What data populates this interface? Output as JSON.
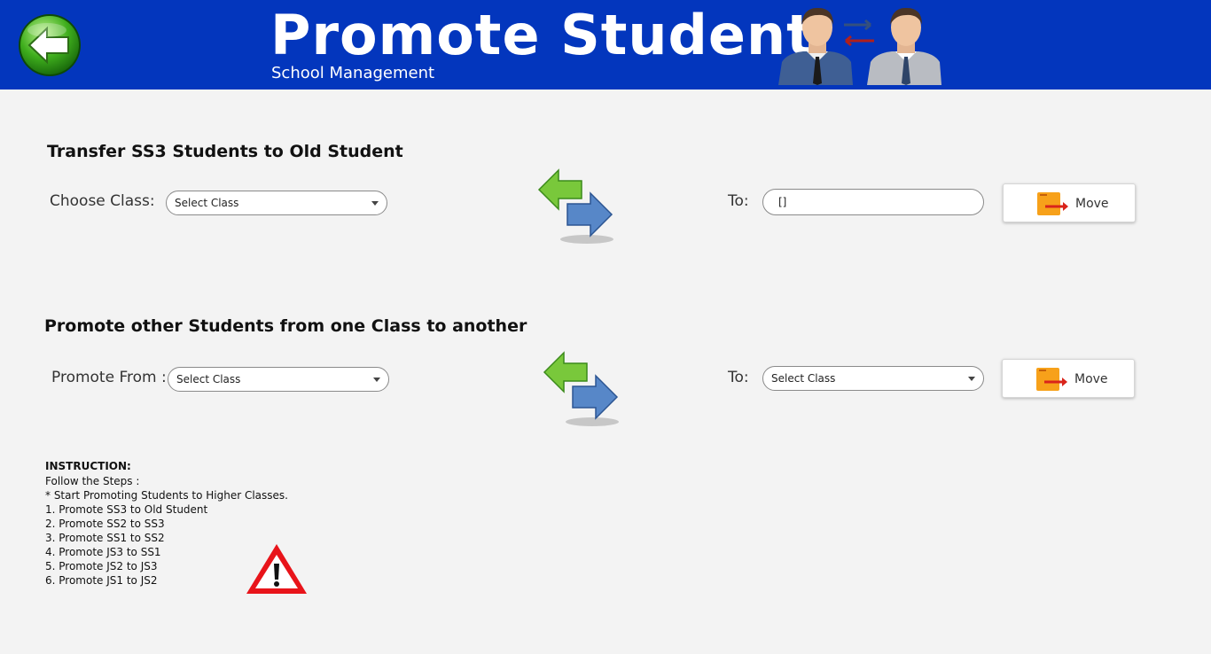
{
  "header": {
    "title": "Promote Student",
    "subtitle": "School Management",
    "background_color": "#0336bd"
  },
  "icons": {
    "back": "back-arrow-icon",
    "people": "students-transfer-icon",
    "arrows": "transfer-arrows-icon",
    "move": "box-move-icon",
    "warning": "warning-icon"
  },
  "transfer": {
    "section_title": "Transfer SS3 Students to Old Student",
    "choose_label": "Choose Class:",
    "choose_value": "Select Class",
    "to_label": "To:",
    "to_value": "[]",
    "move_label": "Move"
  },
  "promote": {
    "section_title": "Promote other Students from one Class to another",
    "from_label": "Promote From :",
    "from_value": "Select Class",
    "to_label": "To:",
    "to_value": "Select Class",
    "move_label": "Move"
  },
  "instruction": {
    "heading": "INSTRUCTION:",
    "lines": [
      "Follow the Steps :",
      "* Start Promoting Students to Higher Classes.",
      "1. Promote SS3 to Old Student",
      "2. Promote SS2 to SS3",
      "3. Promote SS1 to SS2",
      "4. Promote JS3 to SS1",
      "5. Promote JS2 to JS3",
      "6. Promote JS1 to JS2"
    ]
  }
}
